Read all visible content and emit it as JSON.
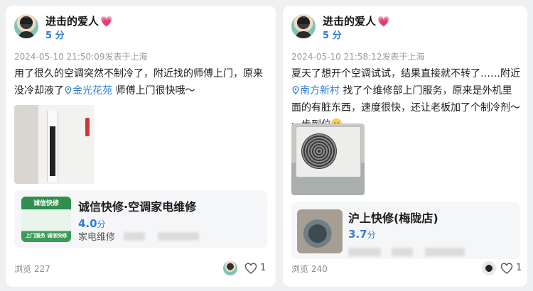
{
  "reviews": [
    {
      "user_name": "进击的爱人",
      "score": "5",
      "score_unit": "分",
      "meta": "2024-05-10 21:50:09发表于上海",
      "text_before": "用了很久的空调突然不制冷了，附近找的师傅上门，原来没冷却液了",
      "location": "金光花苑",
      "text_after": " 师傅上门很快哦～",
      "shop": {
        "name": "诚信快修·空调家电维修",
        "score": "4.0",
        "score_unit": "分",
        "category": "家电维修",
        "thumb_top": "诚信快修",
        "thumb_bottom": "上门服务 诚信快修"
      },
      "views": "浏览 227",
      "likes": "1"
    },
    {
      "user_name": "进击的爱人",
      "score": "5",
      "score_unit": "分",
      "meta": "2024-05-10 21:58:12发表于上海",
      "text_before": "夏天了想开个空调试试，结果直接就不转了……附近",
      "location": "南方新村",
      "text_after": " 找了个维修部上门服务，原来是外机里面的有脏东西，速度很快，还让老板加了个制冷剂～一步到位",
      "shop": {
        "name": "沪上快修(梅陇店)",
        "score": "3.7",
        "score_unit": "分"
      },
      "views": "浏览 240",
      "likes": "1"
    }
  ],
  "icons": {
    "heart_badge": "heart-badge-icon",
    "location_pin": "location-pin-icon",
    "like": "heart-outline-icon",
    "smile": "smile-emoji-icon"
  },
  "colors": {
    "accent_blue": "#2f7fd6",
    "background": "#eef0f2",
    "card": "#ffffff",
    "shop_card": "#f5f6f8"
  }
}
